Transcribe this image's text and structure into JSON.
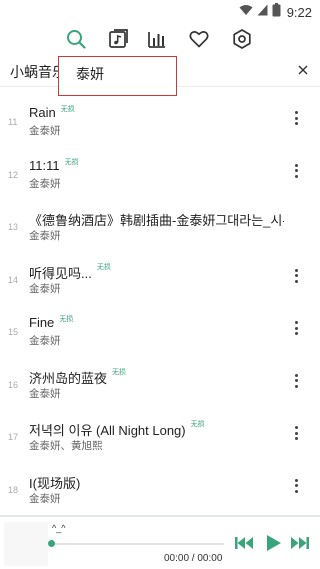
{
  "status_bar": {
    "time": "9:22",
    "icons": [
      "wifi-icon",
      "signal-icon",
      "battery-icon"
    ]
  },
  "top_nav": {
    "items": [
      {
        "name": "search",
        "icon": "search-icon",
        "active": true
      },
      {
        "name": "music-file",
        "icon": "music-file-icon",
        "active": false
      },
      {
        "name": "chart",
        "icon": "bar-chart-icon",
        "active": false
      },
      {
        "name": "favorites",
        "icon": "heart-icon",
        "active": false
      },
      {
        "name": "settings",
        "icon": "settings-icon",
        "active": false
      }
    ]
  },
  "search": {
    "source_label": "小蜗音乐",
    "query": "泰妍"
  },
  "results": [
    {
      "index": "11",
      "title": "Rain",
      "badge": "无损",
      "artist": "金泰妍"
    },
    {
      "index": "12",
      "title": "11:11",
      "badge": "无损",
      "artist": "金泰妍"
    },
    {
      "index": "13",
      "title": "《德鲁纳酒店》韩剧插曲-金泰妍그대라는_시-",
      "badge": "",
      "artist": "金泰妍"
    },
    {
      "index": "14",
      "title": "听得见吗...",
      "badge": "无损",
      "artist": "金泰妍"
    },
    {
      "index": "15",
      "title": "Fine",
      "badge": "无损",
      "artist": "金泰妍"
    },
    {
      "index": "16",
      "title": "济州岛的蓝夜",
      "badge": "无损",
      "artist": "金泰妍"
    },
    {
      "index": "17",
      "title": "저녁의 이유 (All Night Long)",
      "badge": "无损",
      "artist": "金泰妍、黄旭熙"
    },
    {
      "index": "18",
      "title": "I(现场版)",
      "badge": "",
      "artist": "金泰妍"
    }
  ],
  "player": {
    "now_playing": "^_^",
    "time": "00:00 / 00:00",
    "progress": 0,
    "accent_color": "#3aa57a"
  },
  "colors": {
    "accent": "#3aa57a",
    "highlight_box": "#c93a3a"
  }
}
